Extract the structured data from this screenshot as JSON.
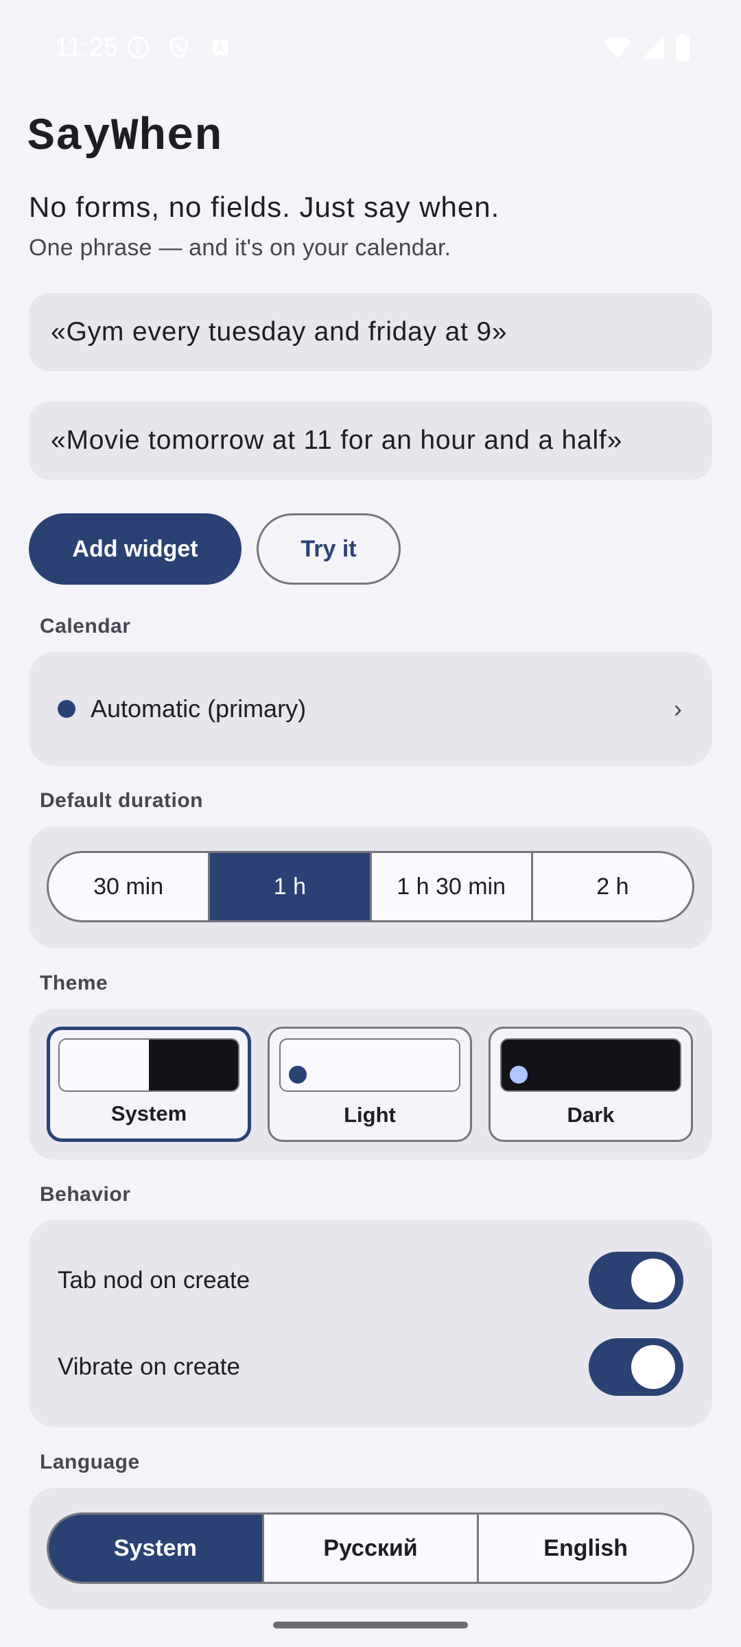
{
  "status_bar": {
    "time": "11:25",
    "left_icons": [
      "info-circle-icon",
      "shield-icon",
      "text-a-icon"
    ],
    "right_icons": [
      "wifi-icon",
      "cell-signal-icon",
      "battery-icon"
    ]
  },
  "header": {
    "title": "SayWhen",
    "tagline": "No forms, no fields. Just say when.",
    "subtagline": "One phrase — and it's on your calendar."
  },
  "examples": [
    "«Gym every tuesday and friday at 9»",
    "«Movie tomorrow at 11 for an hour and a half»"
  ],
  "actions": {
    "primary": "Add widget",
    "secondary": "Try it"
  },
  "calendar": {
    "label": "Calendar",
    "selected": "Automatic (primary)",
    "chevron": "›",
    "dot_color": "#2a4174"
  },
  "duration": {
    "label": "Default duration",
    "options": [
      "30 min",
      "1 h",
      "1 h 30 min",
      "2 h"
    ],
    "selected_index": 1
  },
  "theme": {
    "label": "Theme",
    "options": [
      "System",
      "Light",
      "Dark"
    ],
    "selected_index": 0
  },
  "behavior": {
    "label": "Behavior",
    "toggles": [
      {
        "label": "Tab nod on create",
        "on": true
      },
      {
        "label": "Vibrate on create",
        "on": true
      }
    ]
  },
  "language": {
    "label": "Language",
    "options": [
      "System",
      "Русский",
      "English"
    ],
    "selected_index": 0
  },
  "colors": {
    "accent": "#2a4174",
    "background": "#f4f3f8",
    "surface": "#e7e6ed"
  }
}
